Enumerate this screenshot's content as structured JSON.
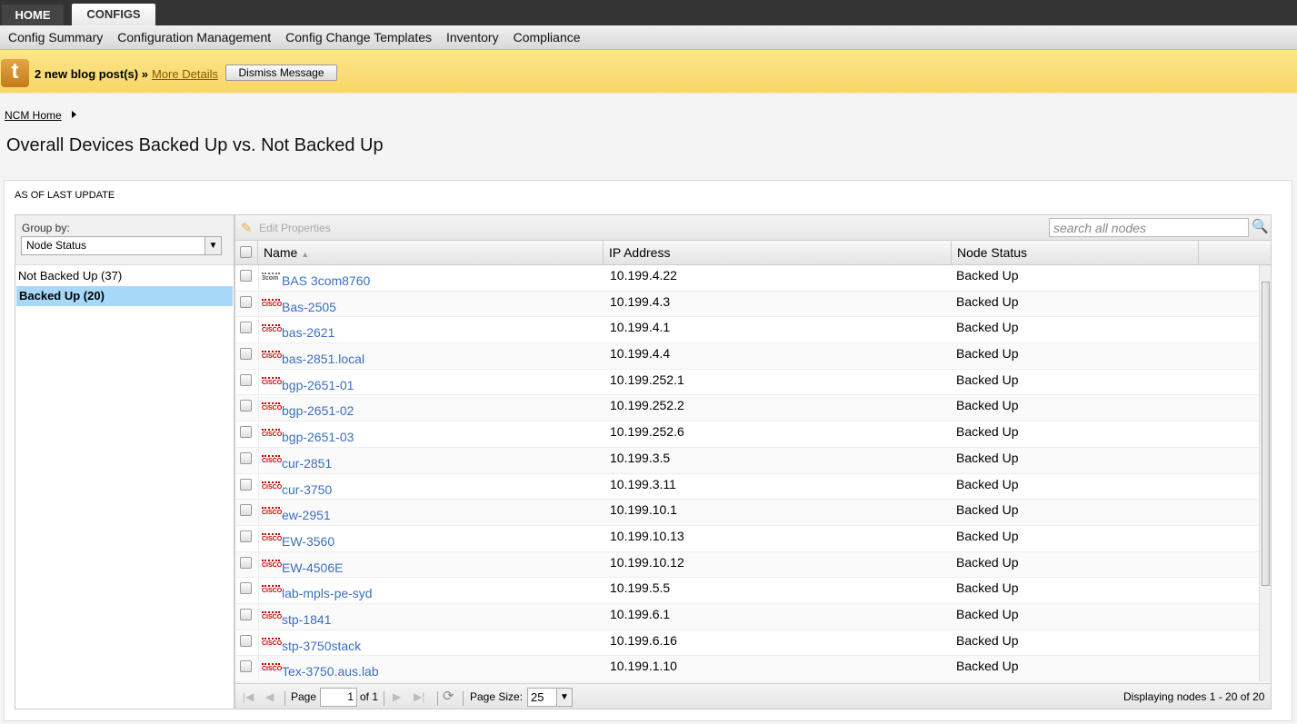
{
  "tabs": [
    "HOME",
    "CONFIGS"
  ],
  "nav": [
    "Config Summary",
    "Configuration Management",
    "Config Change Templates",
    "Inventory",
    "Compliance"
  ],
  "banner": {
    "message": "2 new blog post(s) »",
    "link": "More Details",
    "dismiss": "Dismiss Message",
    "logo": "t"
  },
  "breadcrumb": "NCM Home",
  "title": "Overall Devices Backed Up vs. Not Backed Up",
  "as_of": "AS OF LAST UPDATE",
  "group": {
    "label": "Group by:",
    "selected": "Node Status",
    "items": [
      "Not Backed Up (37)",
      "Backed Up (20)"
    ]
  },
  "toolbar": {
    "edit": "Edit Properties",
    "search_placeholder": "search all nodes"
  },
  "columns": [
    "Name",
    "IP Address",
    "Node Status"
  ],
  "rows": [
    {
      "name": "BAS 3com8760",
      "ip": "10.199.4.22",
      "status": "Backed Up",
      "vendor": "3com"
    },
    {
      "name": "Bas-2505",
      "ip": "10.199.4.3",
      "status": "Backed Up",
      "vendor": "cisco"
    },
    {
      "name": "bas-2621",
      "ip": "10.199.4.1",
      "status": "Backed Up",
      "vendor": "cisco"
    },
    {
      "name": "bas-2851.local",
      "ip": "10.199.4.4",
      "status": "Backed Up",
      "vendor": "cisco"
    },
    {
      "name": "bgp-2651-01",
      "ip": "10.199.252.1",
      "status": "Backed Up",
      "vendor": "cisco"
    },
    {
      "name": "bgp-2651-02",
      "ip": "10.199.252.2",
      "status": "Backed Up",
      "vendor": "cisco"
    },
    {
      "name": "bgp-2651-03",
      "ip": "10.199.252.6",
      "status": "Backed Up",
      "vendor": "cisco"
    },
    {
      "name": "cur-2851",
      "ip": "10.199.3.5",
      "status": "Backed Up",
      "vendor": "cisco"
    },
    {
      "name": "cur-3750",
      "ip": "10.199.3.11",
      "status": "Backed Up",
      "vendor": "cisco"
    },
    {
      "name": "ew-2951",
      "ip": "10.199.10.1",
      "status": "Backed Up",
      "vendor": "cisco"
    },
    {
      "name": "EW-3560",
      "ip": "10.199.10.13",
      "status": "Backed Up",
      "vendor": "cisco"
    },
    {
      "name": "EW-4506E",
      "ip": "10.199.10.12",
      "status": "Backed Up",
      "vendor": "cisco"
    },
    {
      "name": "lab-mpls-pe-syd",
      "ip": "10.199.5.5",
      "status": "Backed Up",
      "vendor": "cisco"
    },
    {
      "name": "stp-1841",
      "ip": "10.199.6.1",
      "status": "Backed Up",
      "vendor": "cisco"
    },
    {
      "name": "stp-3750stack",
      "ip": "10.199.6.16",
      "status": "Backed Up",
      "vendor": "cisco"
    },
    {
      "name": "Tex-3750.aus.lab",
      "ip": "10.199.1.10",
      "status": "Backed Up",
      "vendor": "cisco"
    }
  ],
  "pager": {
    "page_label": "Page",
    "page": "1",
    "of": "of 1",
    "page_size_label": "Page Size:",
    "page_size": "25",
    "display": "Displaying nodes 1 - 20 of 20"
  }
}
